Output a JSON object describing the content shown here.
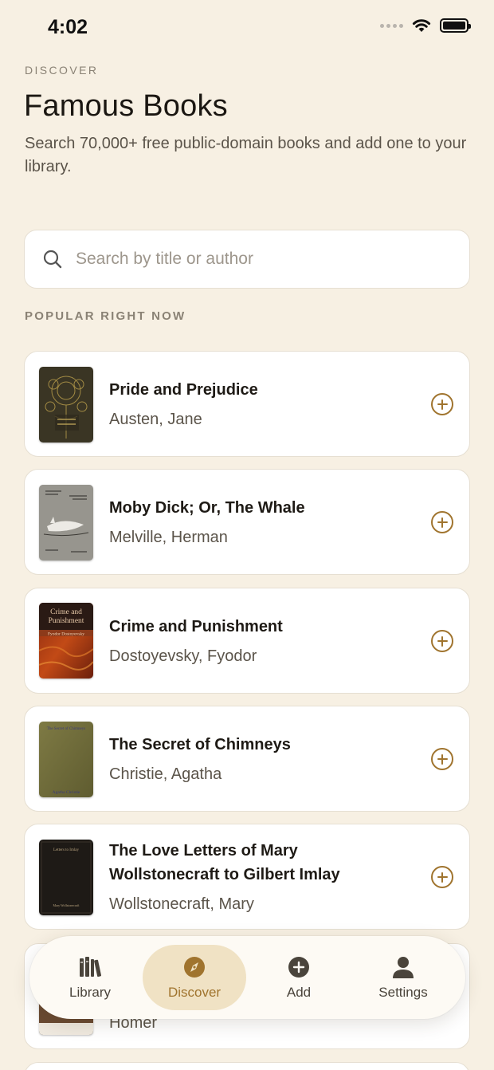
{
  "status": {
    "time": "4:02"
  },
  "header": {
    "eyebrow": "DISCOVER",
    "title": "Famous Books",
    "subtitle": "Search 70,000+ free public-domain books and add one to your library."
  },
  "search": {
    "placeholder": "Search by title or author",
    "value": ""
  },
  "section_label": "POPULAR RIGHT NOW",
  "books": [
    {
      "title": "Pride and Prejudice",
      "author": "Austen, Jane"
    },
    {
      "title": "Moby Dick; Or, The Whale",
      "author": "Melville, Herman"
    },
    {
      "title": "Crime and Punishment",
      "author": "Dostoyevsky, Fyodor"
    },
    {
      "title": "The Secret of Chimneys",
      "author": "Christie, Agatha"
    },
    {
      "title": "The Love Letters of Mary Wollstonecraft to Gilbert Imlay",
      "author": "Wollstonecraft, Mary"
    },
    {
      "title": "",
      "author": "Homer"
    }
  ],
  "covers": {
    "crime_line1": "Crime and",
    "crime_line2": "Punishment",
    "crime_author": "Fyodor Dostoyevsky",
    "chimneys_title": "The Secret of Chimneys",
    "chimneys_author": "Agatha Christie",
    "letters_title": "Letters to Imlay",
    "letters_author": "Mary Wollstonecraft"
  },
  "tabs": [
    {
      "label": "Library",
      "icon": "books-icon",
      "active": false
    },
    {
      "label": "Discover",
      "icon": "compass-icon",
      "active": true
    },
    {
      "label": "Add",
      "icon": "plus-circle-icon",
      "active": false
    },
    {
      "label": "Settings",
      "icon": "person-icon",
      "active": false
    }
  ],
  "colors": {
    "background": "#f7f0e3",
    "accent": "#a0742e",
    "active_tab": "#f0e2c4"
  }
}
